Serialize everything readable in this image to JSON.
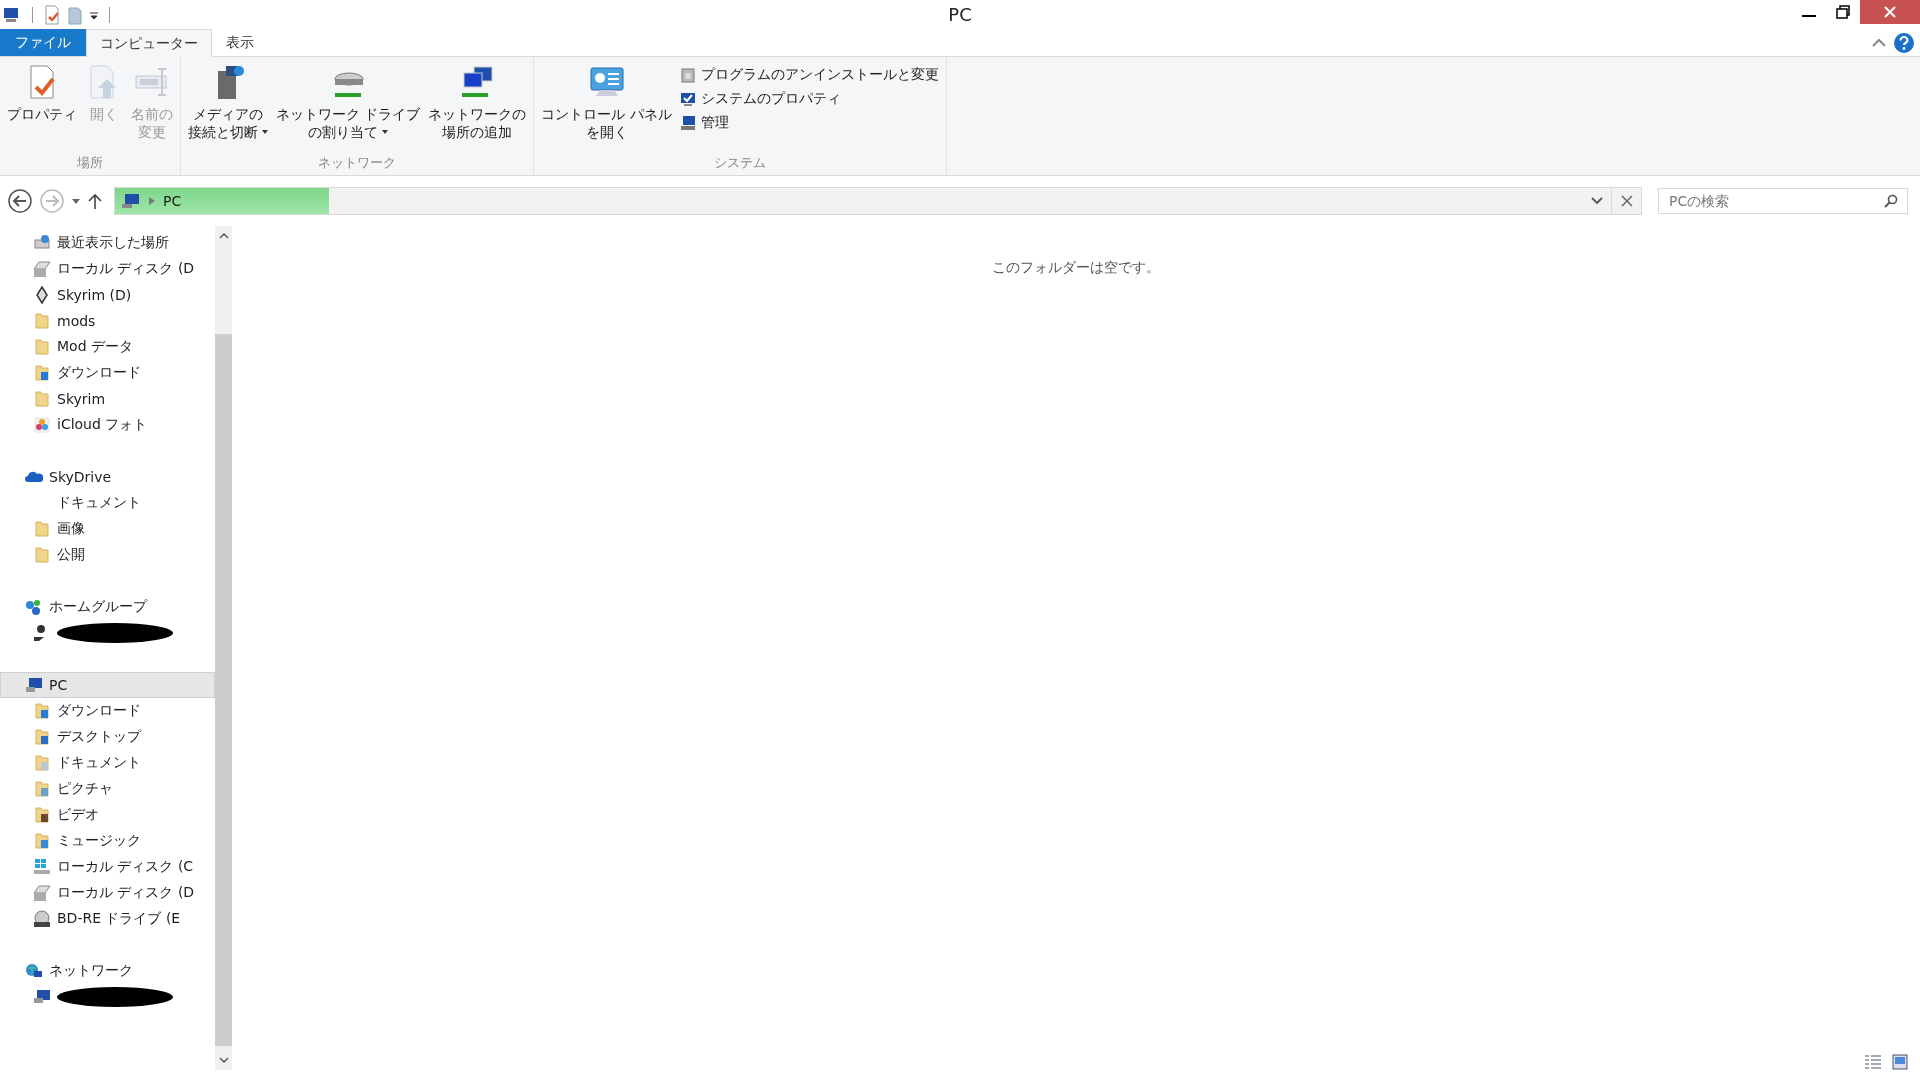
{
  "window": {
    "title": "PC"
  },
  "tabs": [
    {
      "label": "ファイル",
      "kind": "file",
      "selected": false
    },
    {
      "label": "コンピューター",
      "kind": "tab",
      "selected": true
    },
    {
      "label": "表示",
      "kind": "tab",
      "selected": false
    }
  ],
  "ribbon": {
    "groups": [
      {
        "label": "場所",
        "buttons": [
          {
            "lines": [
              "プロパティ"
            ],
            "kind": "properties",
            "disabled": false,
            "dropdown": false
          },
          {
            "lines": [
              "開く"
            ],
            "kind": "open",
            "disabled": true,
            "dropdown": false
          },
          {
            "lines": [
              "名前の",
              "変更"
            ],
            "kind": "rename",
            "disabled": true,
            "dropdown": false
          }
        ]
      },
      {
        "label": "ネットワーク",
        "buttons": [
          {
            "lines": [
              "メディアの",
              "接続と切断"
            ],
            "kind": "media",
            "disabled": false,
            "dropdown": true
          },
          {
            "lines": [
              "ネットワーク ドライブ",
              "の割り当て"
            ],
            "kind": "netdrive",
            "disabled": false,
            "dropdown": true
          },
          {
            "lines": [
              "ネットワークの",
              "場所の追加"
            ],
            "kind": "netplace",
            "disabled": false,
            "dropdown": false
          }
        ]
      },
      {
        "label": "システム",
        "buttons": [
          {
            "lines": [
              "コントロール パネル",
              "を開く"
            ],
            "kind": "control",
            "disabled": false,
            "dropdown": false
          }
        ],
        "small_buttons": [
          {
            "label": "プログラムのアンインストールと変更",
            "kind": "programs",
            "disabled": false
          },
          {
            "label": "システムのプロパティ",
            "kind": "sysprops",
            "disabled": false
          },
          {
            "label": "管理",
            "kind": "manage",
            "disabled": false
          }
        ]
      }
    ]
  },
  "address": {
    "path": "PC",
    "level": 0.14
  },
  "search": {
    "placeholder": "PCの検索"
  },
  "nav": [
    {
      "children": [
        {
          "label": "最近表示した場所",
          "kind": "recent"
        },
        {
          "label": "ローカル ディスク (D",
          "kind": "drive"
        },
        {
          "label": "Skyrim (D)",
          "kind": "game"
        },
        {
          "label": "mods",
          "kind": "folder"
        },
        {
          "label": "Mod データ",
          "kind": "folder"
        },
        {
          "label": "ダウンロード",
          "kind": "download"
        },
        {
          "label": "Skyrim",
          "kind": "folder"
        },
        {
          "label": "iCloud フォト",
          "kind": "photos"
        }
      ]
    },
    {
      "label": "SkyDrive",
      "kind": "cloud",
      "selected": false,
      "children": [
        {
          "label": "ドキュメント",
          "kind": "blank"
        },
        {
          "label": "画像",
          "kind": "folder"
        },
        {
          "label": "公開",
          "kind": "folder"
        }
      ]
    },
    {
      "label": "ホームグループ",
      "kind": "homegroup",
      "selected": false,
      "children": [
        {
          "kind": "user"
        }
      ]
    },
    {
      "label": "PC",
      "kind": "pc",
      "selected": true,
      "children": [
        {
          "label": "ダウンロード",
          "kind": "download"
        },
        {
          "label": "デスクトップ",
          "kind": "desktop"
        },
        {
          "label": "ドキュメント",
          "kind": "documents"
        },
        {
          "label": "ピクチャ",
          "kind": "pictures"
        },
        {
          "label": "ビデオ",
          "kind": "videos"
        },
        {
          "label": "ミュージック",
          "kind": "music"
        },
        {
          "label": "ローカル ディスク (C",
          "kind": "windrive"
        },
        {
          "label": "ローカル ディスク (D",
          "kind": "drive"
        },
        {
          "label": "BD-RE ドライブ (E",
          "kind": "bd"
        }
      ]
    },
    {
      "label": "ネットワーク",
      "kind": "network",
      "selected": false,
      "children": [
        {
          "kind": "computer"
        }
      ]
    }
  ],
  "content": {
    "empty_message": "このフォルダーは空です。"
  }
}
